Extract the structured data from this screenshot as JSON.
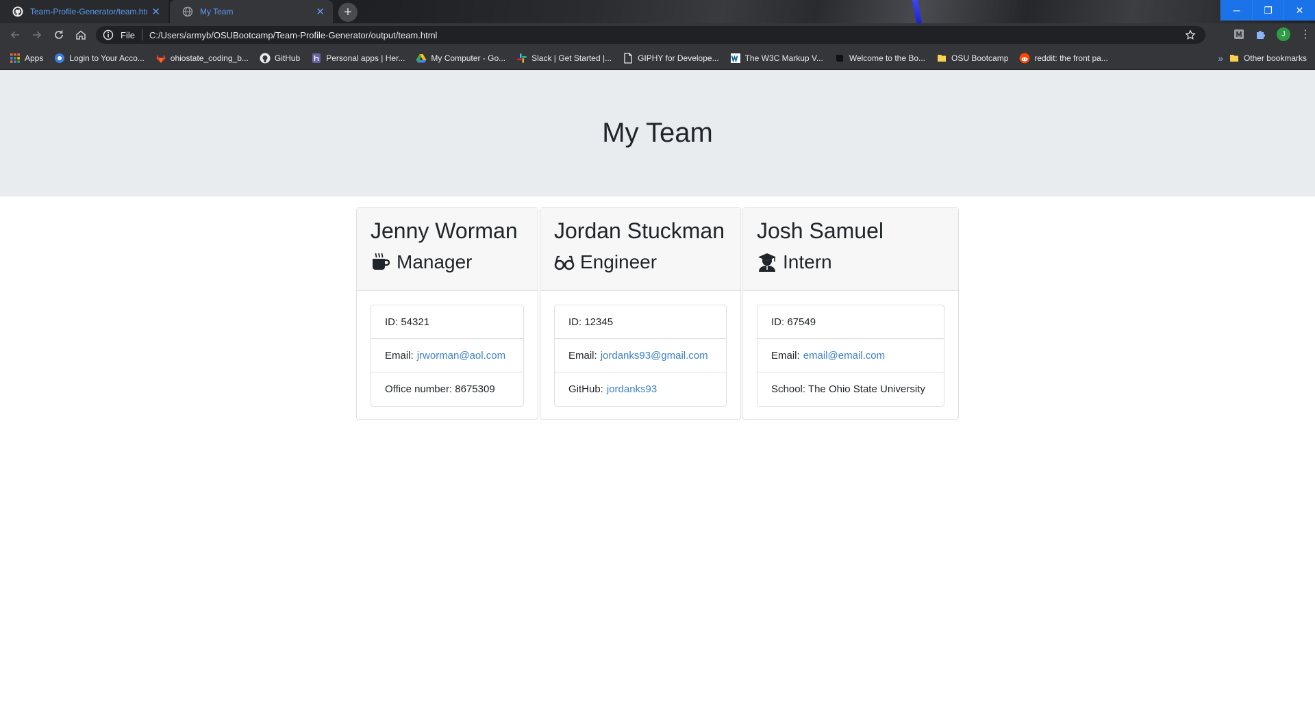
{
  "browser": {
    "tabs": [
      {
        "title": "Team-Profile-Generator/team.htm",
        "icon": "github-icon",
        "active": false
      },
      {
        "title": "My Team",
        "icon": "globe-icon",
        "active": true
      }
    ],
    "new_tab_label": "+",
    "window_controls": {
      "minimize": "─",
      "restore": "❐",
      "close": "✕"
    },
    "address": {
      "scheme": "File",
      "url": "C:/Users/armyb/OSUBootcamp/Team-Profile-Generator/output/team.html"
    },
    "profile_initial": "J",
    "bookmarks": [
      {
        "label": "Apps",
        "icon": "apps-grid-icon"
      },
      {
        "label": "Login to Your Acco...",
        "icon": "globe-icon"
      },
      {
        "label": "ohiostate_coding_b...",
        "icon": "gitlab-icon"
      },
      {
        "label": "GitHub",
        "icon": "github-icon"
      },
      {
        "label": "Personal apps | Her...",
        "icon": "heroku-icon"
      },
      {
        "label": "My Computer - Go...",
        "icon": "google-drive-icon"
      },
      {
        "label": "Slack | Get Started |...",
        "icon": "slack-icon"
      },
      {
        "label": "GIPHY for Develope...",
        "icon": "giphy-icon"
      },
      {
        "label": "The W3C Markup V...",
        "icon": "w3c-icon"
      },
      {
        "label": "Welcome to the Bo...",
        "icon": "bootcamp-icon"
      },
      {
        "label": "OSU Bootcamp",
        "icon": "folder-icon"
      },
      {
        "label": "reddit: the front pa...",
        "icon": "reddit-icon"
      }
    ],
    "bookmarks_overflow": "»",
    "other_bookmarks": "Other bookmarks"
  },
  "page": {
    "title": "My Team",
    "employees": [
      {
        "name": "Jenny Worman",
        "role": "Manager",
        "role_icon": "coffee-mug-icon",
        "id_label": "ID: 54321",
        "email_prefix": "Email:",
        "email": "jrworman@aol.com",
        "extra_prefix": "Office number: 8675309",
        "extra_link": ""
      },
      {
        "name": "Jordan Stuckman",
        "role": "Engineer",
        "role_icon": "glasses-icon",
        "id_label": "ID: 12345",
        "email_prefix": "Email:",
        "email": "jordanks93@gmail.com",
        "extra_prefix": "GitHub:",
        "extra_link": "jordanks93"
      },
      {
        "name": "Josh Samuel",
        "role": "Intern",
        "role_icon": "graduate-icon",
        "id_label": "ID: 67549",
        "email_prefix": "Email:",
        "email": "email@email.com",
        "extra_prefix": "School: The Ohio State University",
        "extra_link": ""
      }
    ]
  },
  "colors": {
    "link": "#3b7fcb",
    "jumbotron": "#e9ecef",
    "chrome_accent": "#1a73e8"
  }
}
